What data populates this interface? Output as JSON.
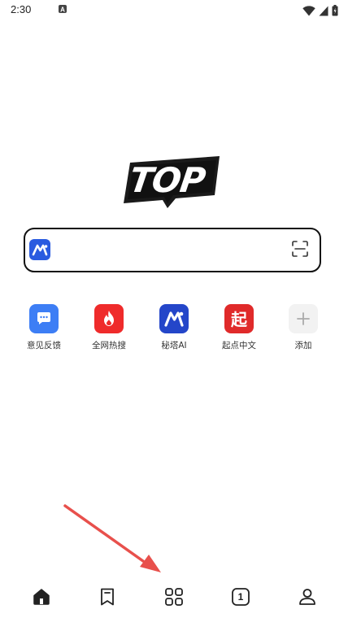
{
  "status_bar": {
    "time": "2:30"
  },
  "search": {
    "placeholder": "",
    "value": ""
  },
  "shortcuts": [
    {
      "label": "意见反馈",
      "icon": "feedback-icon",
      "color": "#3d7ef5"
    },
    {
      "label": "全网热搜",
      "icon": "fire-icon",
      "color": "#ef2b2b"
    },
    {
      "label": "秘塔AI",
      "icon": "metaso-icon",
      "color": "#2446c9"
    },
    {
      "label": "起点中文",
      "icon": "qidian-icon",
      "color": "#e02a2a"
    },
    {
      "label": "添加",
      "icon": "plus-icon",
      "color": "#f2f2f2"
    }
  ],
  "bottom_nav": {
    "items": [
      "home-icon",
      "bookmark-icon",
      "grid-icon",
      "tabs-icon",
      "profile-icon"
    ],
    "tab_count": "1"
  },
  "colors": {
    "accent_blue": "#2a5be0",
    "annotation_red": "#e8504c"
  }
}
